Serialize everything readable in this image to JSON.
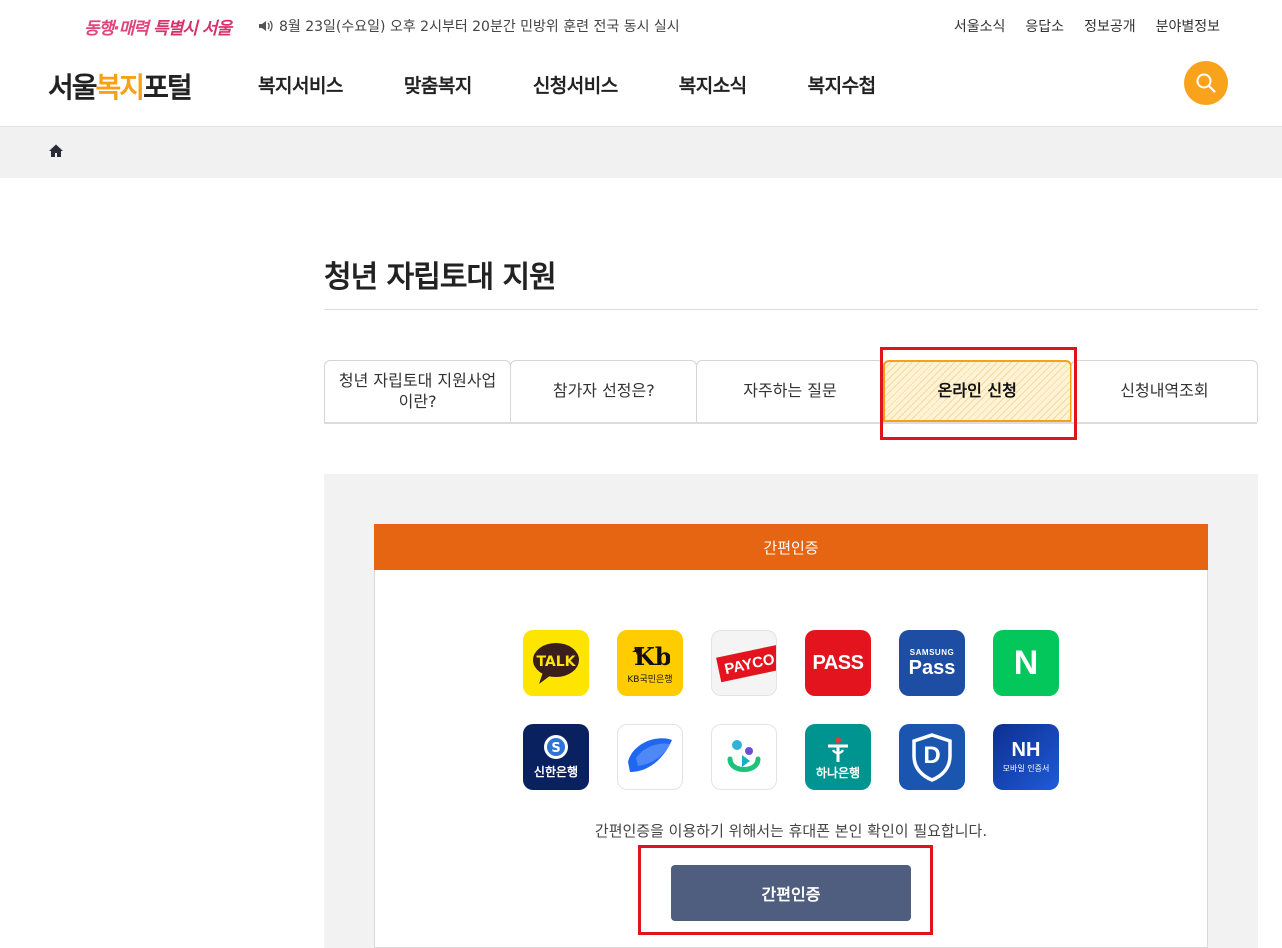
{
  "topbar": {
    "slogan_a": "동행·매력",
    "slogan_b": "특별시 서울",
    "notice": "8월 23일(수요일) 오후 2시부터 20분간 민방위 훈련 전국 동시 실시",
    "links": [
      "서울소식",
      "응답소",
      "정보공개",
      "분야별정보"
    ]
  },
  "header": {
    "logo_a": "서울",
    "logo_b": "복지",
    "logo_c": "포털",
    "nav": [
      "복지서비스",
      "맞춤복지",
      "신청서비스",
      "복지소식",
      "복지수첩"
    ]
  },
  "page": {
    "title": "청년 자립토대 지원"
  },
  "tabs": [
    {
      "label": "청년 자립토대 지원사업 이란?"
    },
    {
      "label": "참가자 선정은?"
    },
    {
      "label": "자주하는 질문"
    },
    {
      "label": "온라인 신청",
      "active": true
    },
    {
      "label": "신청내역조회"
    }
  ],
  "auth": {
    "header": "간편인증",
    "description": "간편인증을 이용하기 위해서는 휴대폰 본인 확인이 필요합니다.",
    "button_label": "간편인증",
    "providers": [
      {
        "name": "kakao-talk",
        "text": "TALK",
        "bg": "#fee500"
      },
      {
        "name": "kb-bank",
        "text": "KB국민은행",
        "bg": "#ffcc00"
      },
      {
        "name": "payco",
        "text": "PAYCO",
        "bg": "#f4f4f4"
      },
      {
        "name": "pass",
        "text": "PASS",
        "bg": "#e4141e"
      },
      {
        "name": "samsung-pass",
        "text_a": "SAMSUNG",
        "text_b": "Pass",
        "bg": "#1d4ea3"
      },
      {
        "name": "naver",
        "text": "N",
        "bg": "#03c75a"
      },
      {
        "name": "shinhan-bank",
        "text": "신한은행",
        "bg": "#0a2160"
      },
      {
        "name": "toss",
        "bg": "#ffffff"
      },
      {
        "name": "banksalad",
        "bg": "#ffffff"
      },
      {
        "name": "hana-bank",
        "text": "하나은행",
        "bg": "#009490"
      },
      {
        "name": "d-sign",
        "text": "D",
        "bg": "#1a56b0"
      },
      {
        "name": "nh-bank",
        "text_a": "NH",
        "text_b": "모바일 인증서",
        "bg": "#0c3fb7"
      }
    ]
  }
}
